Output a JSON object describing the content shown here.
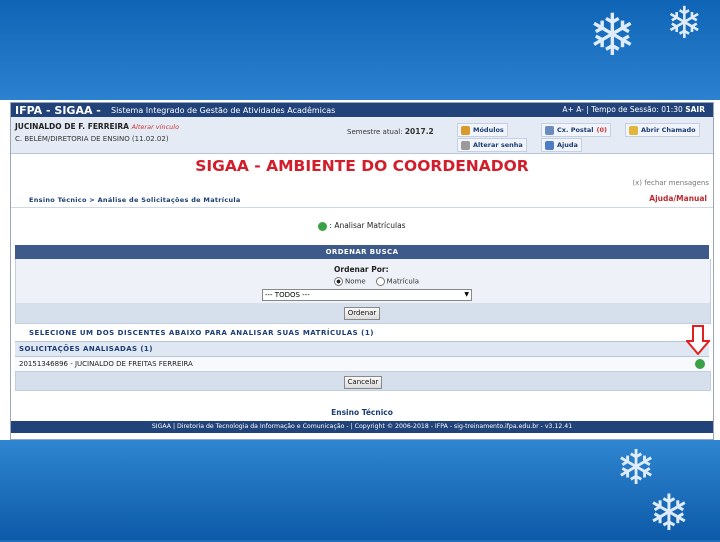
{
  "topbar": {
    "system": "IFPA - SIGAA -",
    "system_full": "Sistema Integrado de Gestão de Atividades Acadêmicas",
    "font_controls": "A+  A-",
    "session": "Tempo de Sessão: 01:30",
    "exit": "SAIR"
  },
  "user": {
    "name": "JUCINALDO DE F. FERREIRA",
    "alter_link": "Alterar vínculo",
    "department": "C. BELÉM/DIRETORIA DE ENSINO (11.02.02)",
    "semester_label": "Semestre atual:",
    "semester_value": "2017.2"
  },
  "menu": {
    "modulos": "Módulos",
    "cx_postal": "Cx. Postal",
    "cx_postal_count": "(0)",
    "abrir_chamado": "Abrir Chamado",
    "alterar_senha": "Alterar senha",
    "ajuda": "Ajuda"
  },
  "page": {
    "heading": "SIGAA - AMBIENTE DO COORDENADOR",
    "fechar_mensagens": "(x) fechar mensagens",
    "breadcrumb": "Ensino Técnico > Análise de Solicitações de Matrícula",
    "ajuda_manual": "Ajuda/Manual",
    "analisar_label": ": Analisar Matrículas"
  },
  "form": {
    "title": "ORDENAR BUSCA",
    "order_by_label": "Ordenar Por:",
    "radio_nome": "Nome",
    "radio_matricula": "Matrícula",
    "select_value": "--- TODOS ---",
    "ordenar_button": "Ordenar"
  },
  "list": {
    "instruction": "SELECIONE UM DOS DISCENTES ABAIXO PARA ANALISAR SUAS MATRÍCULAS (1)",
    "group_title": "SOLICITAÇÕES ANALISADAS (1)",
    "row": "20151346896 - JUCINALDO DE FREITAS FERREIRA",
    "cancel_button": "Cancelar"
  },
  "footer": {
    "section": "Ensino Técnico",
    "text": "SIGAA | Diretoria de Tecnologia da Informação e Comunicação - | Copyright © 2006-2018 - IFPA - sig-treinamento.ifpa.edu.br - v3.12.41"
  },
  "colors": {
    "header_blue": "#22437a",
    "heading_red": "#d21d2b",
    "annotation_arrow": "#e02020"
  }
}
